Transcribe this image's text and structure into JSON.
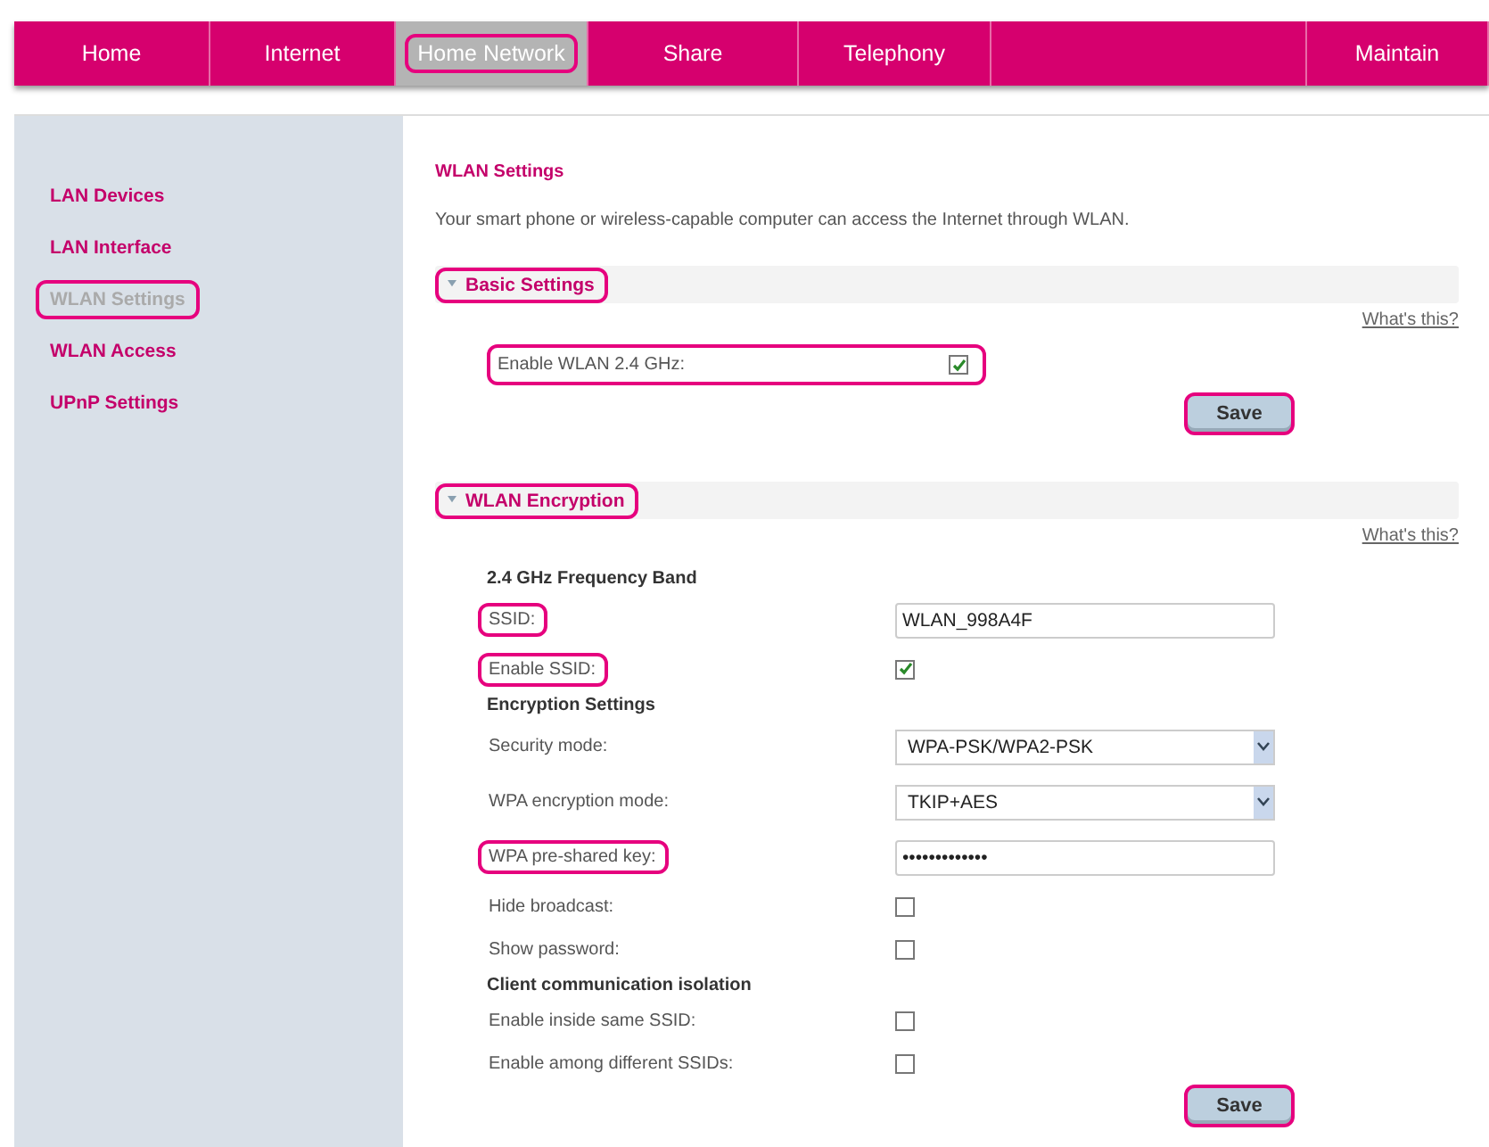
{
  "nav": [
    {
      "label": "Home",
      "selected": false,
      "highlighted": false
    },
    {
      "label": "Internet",
      "selected": false,
      "highlighted": false
    },
    {
      "label": "Home Network",
      "selected": true,
      "highlighted": true
    },
    {
      "label": "Share",
      "selected": false,
      "highlighted": false
    },
    {
      "label": "Telephony",
      "selected": false,
      "highlighted": false
    },
    {
      "selected": false
    },
    {
      "label": "Maintain",
      "selected": false,
      "highlighted": false
    }
  ],
  "sidebar": {
    "items": [
      {
        "label": "LAN Devices",
        "selected": false,
        "highlighted": false
      },
      {
        "label": "LAN Interface",
        "selected": false,
        "highlighted": false
      },
      {
        "label": "WLAN Settings",
        "selected": true,
        "highlighted": true
      },
      {
        "label": "WLAN Access",
        "selected": false,
        "highlighted": false
      },
      {
        "label": "UPnP Settings",
        "selected": false,
        "highlighted": false
      }
    ]
  },
  "page": {
    "title": "WLAN Settings",
    "description": "Your smart phone or wireless-capable computer can access the Internet through WLAN."
  },
  "sections": [
    {
      "title": "Basic Settings",
      "expanded": true,
      "highlighted": true,
      "help_link": "What's this?",
      "save_button": "Save",
      "rows": [
        {
          "kind": "checkbox",
          "label": "Enable WLAN 2.4 GHz:",
          "checked": true,
          "highlighted": true
        }
      ]
    },
    {
      "title": "WLAN Encryption",
      "expanded": true,
      "highlighted": true,
      "help_link": "What's this?",
      "save_button": "Save",
      "rows": [
        {
          "kind": "heading",
          "label": "2.4 GHz Frequency Band"
        },
        {
          "kind": "text",
          "label": "SSID:",
          "value": "WLAN_998A4F",
          "highlighted": true
        },
        {
          "kind": "checkbox",
          "label": "Enable SSID:",
          "checked": true,
          "highlighted": true
        },
        {
          "kind": "heading",
          "label": "Encryption Settings"
        },
        {
          "kind": "select",
          "label": "Security mode:",
          "value": "WPA-PSK/WPA2-PSK",
          "highlighted": false
        },
        {
          "kind": "select",
          "label": "WPA encryption mode:",
          "value": "TKIP+AES",
          "highlighted": false
        },
        {
          "kind": "text",
          "label": "WPA pre-shared key:",
          "value": "•••••••••••••",
          "highlighted": true
        },
        {
          "kind": "checkbox",
          "label": "Hide broadcast:",
          "checked": false,
          "highlighted": false
        },
        {
          "kind": "checkbox",
          "label": "Show password:",
          "checked": false,
          "highlighted": false
        },
        {
          "kind": "heading",
          "label": "Client communication isolation"
        },
        {
          "kind": "checkbox",
          "label": "Enable inside same SSID:",
          "checked": false,
          "highlighted": false
        },
        {
          "kind": "checkbox",
          "label": "Enable among different SSIDs:",
          "checked": false,
          "highlighted": false
        }
      ]
    }
  ]
}
